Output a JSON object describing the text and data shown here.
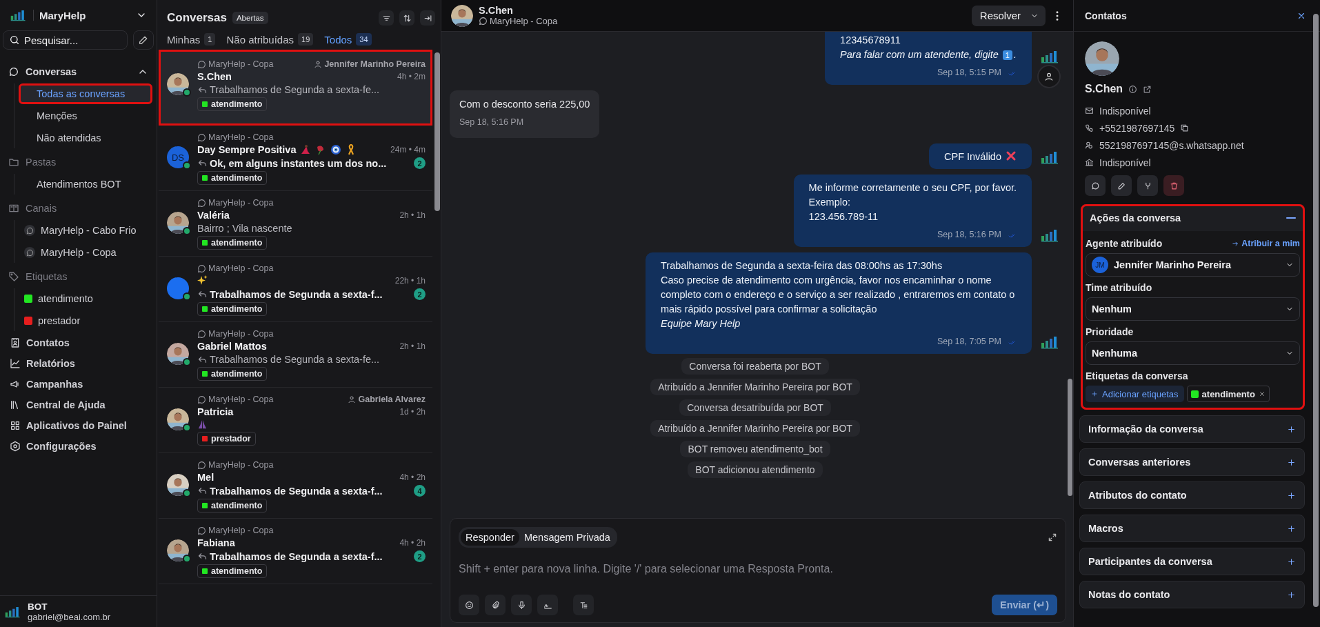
{
  "sidebar": {
    "brand": "MaryHelp",
    "search_label": "Pesquisar...",
    "sections": [
      {
        "kind": "group",
        "label": "Conversas",
        "expanded": true,
        "children": [
          {
            "label": "Todas as conversas",
            "selected": true,
            "highlighted": true
          },
          {
            "label": "Menções",
            "selected": false,
            "highlighted": false
          },
          {
            "label": "Não atendidas",
            "selected": false,
            "highlighted": false
          }
        ]
      },
      {
        "kind": "folders",
        "label": "Pastas",
        "children": [
          {
            "label": "Atendimentos BOT",
            "selected": false
          }
        ]
      },
      {
        "kind": "channels",
        "label": "Canais",
        "children": [
          {
            "label": "MaryHelp - Cabo Frio",
            "selected": false
          },
          {
            "label": "MaryHelp - Copa",
            "selected": false
          }
        ]
      },
      {
        "kind": "labels",
        "label": "Etiquetas",
        "children": [
          {
            "label": "atendimento",
            "selected": false,
            "color": "#22e622"
          },
          {
            "label": "prestador",
            "selected": false,
            "color": "#e61e1e"
          }
        ]
      },
      {
        "kind": "link",
        "label": "Contatos",
        "selected": false
      },
      {
        "kind": "link",
        "label": "Relatórios",
        "selected": false
      },
      {
        "kind": "link",
        "label": "Campanhas",
        "selected": false
      },
      {
        "kind": "link",
        "label": "Central de Ajuda",
        "selected": false
      },
      {
        "kind": "link",
        "label": "Aplicativos do Painel",
        "selected": false
      },
      {
        "kind": "link",
        "label": "Configurações",
        "selected": false
      }
    ],
    "user": {
      "name": "BOT",
      "email": "gabriel@beai.com.br"
    }
  },
  "conversations": {
    "title": "Conversas",
    "status": "Abertas",
    "tabs": [
      {
        "label": "Minhas",
        "count": "1",
        "selected": false
      },
      {
        "label": "Não atribuídas",
        "count": "19",
        "selected": false
      },
      {
        "label": "Todos",
        "count": "34",
        "selected": true
      }
    ],
    "items": [
      {
        "avatar": {
          "kind": "photo"
        },
        "inbox": "MaryHelp - Copa",
        "assignee": "Jennifer Marinho Pereira",
        "title": {
          "kind": "plain",
          "text": "S.Chen"
        },
        "time": "4h • 2m",
        "reply": true,
        "preview": {
          "kind": "text",
          "text": "Trabalhamos de Segunda a sexta-fe..."
        },
        "label": {
          "text": "atendimento",
          "color": "#22e622"
        },
        "selected": true,
        "highlighted": true
      },
      {
        "avatar": {
          "kind": "initials",
          "text": "DS"
        },
        "inbox": "MaryHelp - Copa",
        "title": {
          "kind": "decorated",
          "text": "Day Sempre Positiva"
        },
        "time": "24m • 4m",
        "reply": true,
        "preview": {
          "kind": "text",
          "text": "Ok, em alguns instantes um dos no..."
        },
        "unread": "2",
        "label": {
          "text": "atendimento",
          "color": "#22e622"
        },
        "selected": false,
        "highlighted": false
      },
      {
        "avatar": {
          "kind": "photo"
        },
        "inbox": "MaryHelp - Copa",
        "title": {
          "kind": "plain",
          "text": "Valéria"
        },
        "time": "2h • 1h",
        "reply": false,
        "preview": {
          "kind": "text",
          "text": "Bairro ; Vila nascente"
        },
        "label": {
          "text": "atendimento",
          "color": "#22e622"
        },
        "selected": false,
        "highlighted": false
      },
      {
        "avatar": {
          "kind": "blank"
        },
        "inbox": "MaryHelp - Copa",
        "title": {
          "kind": "sparkle"
        },
        "time": "22h • 1h",
        "reply": true,
        "preview": {
          "kind": "text",
          "text": "Trabalhamos de Segunda a sexta-f..."
        },
        "unread": "2",
        "label": {
          "text": "atendimento",
          "color": "#22e622"
        },
        "selected": false,
        "highlighted": false
      },
      {
        "avatar": {
          "kind": "photo"
        },
        "inbox": "MaryHelp - Copa",
        "title": {
          "kind": "plain",
          "text": "Gabriel Mattos"
        },
        "time": "2h • 1h",
        "reply": true,
        "preview": {
          "kind": "text",
          "text": "Trabalhamos de Segunda a sexta-fe..."
        },
        "label": {
          "text": "atendimento",
          "color": "#22e622"
        },
        "selected": false,
        "highlighted": false
      },
      {
        "avatar": {
          "kind": "photo"
        },
        "inbox": "MaryHelp - Copa",
        "assignee": "Gabriela Alvarez",
        "title": {
          "kind": "plain",
          "text": "Patricia"
        },
        "time": "1d • 2h",
        "reply": false,
        "preview": {
          "kind": "hands"
        },
        "label": {
          "text": "prestador",
          "color": "#e61e1e"
        },
        "selected": false,
        "highlighted": false
      },
      {
        "avatar": {
          "kind": "photo"
        },
        "inbox": "MaryHelp - Copa",
        "title": {
          "kind": "plain",
          "text": "Mel"
        },
        "time": "4h • 2h",
        "reply": true,
        "preview": {
          "kind": "text",
          "text": "Trabalhamos de Segunda a sexta-f..."
        },
        "unread": "4",
        "label": {
          "text": "atendimento",
          "color": "#22e622"
        },
        "selected": false,
        "highlighted": false
      },
      {
        "avatar": {
          "kind": "photo"
        },
        "inbox": "MaryHelp - Copa",
        "title": {
          "kind": "plain",
          "text": "Fabiana"
        },
        "time": "4h • 2h",
        "reply": true,
        "preview": {
          "kind": "text",
          "text": "Trabalhamos de Segunda a sexta-f..."
        },
        "unread": "2",
        "label": {
          "text": "atendimento",
          "color": "#22e622"
        },
        "selected": false,
        "highlighted": false
      }
    ]
  },
  "chat": {
    "name": "S.Chen",
    "inbox": "MaryHelp - Copa",
    "resolve": "Resolver",
    "messages": [
      {
        "kind": "outgoing",
        "lines": [
          {
            "text": "12345678911",
            "italic": false
          },
          {
            "text": "Para falar com um atendente, digite",
            "italic": true,
            "keycap": "1",
            "after": "."
          }
        ],
        "time": "Sep 18, 5:15 PM"
      },
      {
        "kind": "incoming",
        "lines": [
          {
            "text": "Com o desconto seria 225,00",
            "italic": false
          }
        ],
        "time": "Sep 18, 5:16 PM"
      },
      {
        "kind": "outgoing",
        "lines": [
          {
            "text": "CPF Inválido",
            "italic": false,
            "cross": true
          }
        ]
      },
      {
        "kind": "outgoing",
        "lines": [
          {
            "text": "Me informe corretamente o seu CPF, por favor.",
            "italic": false
          },
          {
            "text": "Exemplo:",
            "italic": false
          },
          {
            "text": "123.456.789-11",
            "italic": false
          }
        ],
        "time": "Sep 18, 5:16 PM"
      },
      {
        "kind": "outgoing",
        "lines": [
          {
            "text": "Trabalhamos de Segunda a sexta-feira das 08:00hs as 17:30hs",
            "italic": false
          },
          {
            "text": "Caso precise de atendimento com urgência, favor nos encaminhar o nome completo com o endereço e o serviço a ser realizado , entraremos em contato o mais rápido possível para confirmar a solicitação",
            "italic": false
          },
          {
            "text": "Equipe Mary Help",
            "italic": true
          }
        ],
        "time": "Sep 18, 7:05 PM"
      },
      {
        "kind": "activity",
        "text": "Conversa foi reaberta por BOT"
      },
      {
        "kind": "activity",
        "text": "Atribuído a Jennifer Marinho Pereira por BOT"
      },
      {
        "kind": "activity",
        "text": "Conversa desatribuída por BOT"
      },
      {
        "kind": "activity",
        "text": "Atribuído a Jennifer Marinho Pereira por BOT"
      },
      {
        "kind": "activity",
        "text": "BOT removeu atendimento_bot"
      },
      {
        "kind": "activity",
        "text": "BOT adicionou atendimento"
      }
    ],
    "composer": {
      "modes": [
        {
          "label": "Responder",
          "selected": true
        },
        {
          "label": "Mensagem Privada",
          "selected": false
        }
      ],
      "placeholder": "Shift + enter para nova linha. Digite '/' para selecionar uma Resposta Pronta.",
      "send": "Enviar (↵)"
    }
  },
  "contact": {
    "title": "Contatos",
    "name": "S.Chen",
    "details": [
      {
        "kind": "email",
        "text": "Indisponível"
      },
      {
        "kind": "phone",
        "text": "+5521987697145",
        "copy": true
      },
      {
        "kind": "identifier",
        "text": "5521987697145@s.whatsapp.net"
      },
      {
        "kind": "company",
        "text": "Indisponível"
      }
    ],
    "actions": {
      "title": "Ações da conversa",
      "expanded": true,
      "highlighted": true,
      "agent_label": "Agente atribuído",
      "assign_me": "Atribuir a mim",
      "agent_initials": "JM",
      "agent": "Jennifer Marinho Pereira",
      "team_label": "Time atribuído",
      "team": "Nenhum",
      "priority_label": "Prioridade",
      "priority": "Nenhuma",
      "labels_title": "Etiquetas da conversa",
      "add_labels": "Adicionar etiquetas",
      "labels": [
        {
          "text": "atendimento",
          "color": "#22e622"
        }
      ]
    },
    "sections": [
      {
        "title": "Informação da conversa",
        "expanded": false
      },
      {
        "title": "Conversas anteriores",
        "expanded": false
      },
      {
        "title": "Atributos do contato",
        "expanded": false
      },
      {
        "title": "Macros",
        "expanded": false
      },
      {
        "title": "Participantes da conversa",
        "expanded": false
      },
      {
        "title": "Notas do contato",
        "expanded": false
      }
    ]
  }
}
